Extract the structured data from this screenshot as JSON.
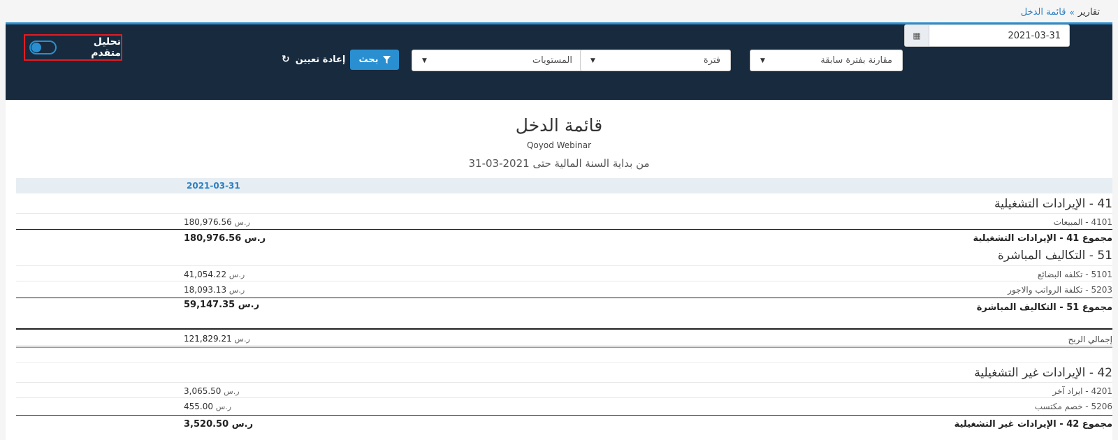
{
  "breadcrumb": {
    "parent": "تقارير",
    "separator": "»",
    "current": "قائمة الدخل"
  },
  "filters": {
    "date_value": "2021-03-31",
    "comparison": "مقارنة بفترة سابقة",
    "period": "فترة",
    "levels": "المستويات",
    "search_label": "بحث",
    "reset_label": "إعادة تعيين",
    "advanced_label": "تحليل متقدم",
    "advanced_on": false
  },
  "report": {
    "title": "قائمة الدخل",
    "company": "Qoyod Webinar",
    "period": "من بداية السنة المالية حتى 2021-03-31",
    "column_header": "2021-03-31",
    "currency": "ر.س",
    "sections": [
      {
        "title": "41 - الإيرادات التشغيلية",
        "items": [
          {
            "label": "4101 - المبيعات",
            "amount": "180,976.56"
          }
        ],
        "total_label": "مجموع 41 - الإيرادات التشغيلية",
        "total_amount": "180,976.56"
      },
      {
        "title": "51 - التكاليف المباشرة",
        "items": [
          {
            "label": "5101 - تكلفه البضائع",
            "amount": "41,054.22"
          },
          {
            "label": "5203 - تكلفة الرواتب والاجور",
            "amount": "18,093.13"
          }
        ],
        "total_label": "مجموع 51 - التكاليف المباشرة",
        "total_amount": "59,147.35"
      },
      {
        "title": "42 - الإيرادات غير التشغيلية",
        "items": [
          {
            "label": "4201 - ايراد آخر",
            "amount": "3,065.50"
          },
          {
            "label": "5206 - خصم مكتسب",
            "amount": "455.00"
          }
        ],
        "total_label": "مجموع 42 - الإيرادات غير التشغيلية",
        "total_amount": "3,520.50"
      }
    ],
    "gross_profit_label": "إجمالي الربح",
    "gross_profit_amount": "121,829.21"
  }
}
